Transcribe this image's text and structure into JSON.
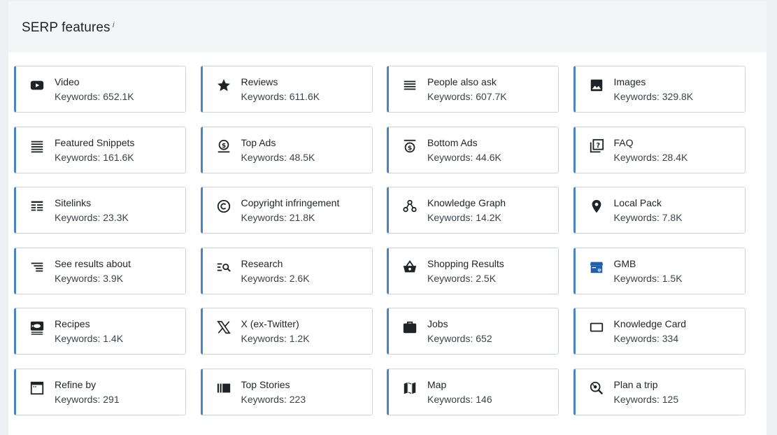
{
  "panel": {
    "title": "SERP features",
    "info_mark": "i"
  },
  "colors": {
    "accent_border": "#4a83c8",
    "card_border": "#cfd4db",
    "header_bg": "#f4f5f7"
  },
  "keywords_prefix": "Keywords: ",
  "features": [
    {
      "name": "Video",
      "keywords": "Keywords: 652.1K",
      "icon": "youtube-icon"
    },
    {
      "name": "Reviews",
      "keywords": "Keywords: 611.6K",
      "icon": "star-icon"
    },
    {
      "name": "People also ask",
      "keywords": "Keywords: 607.7K",
      "icon": "lines-icon"
    },
    {
      "name": "Images",
      "keywords": "Keywords: 329.8K",
      "icon": "image-icon"
    },
    {
      "name": "Featured Snippets",
      "keywords": "Keywords: 161.6K",
      "icon": "snippet-lines-icon"
    },
    {
      "name": "Top Ads",
      "keywords": "Keywords: 48.5K",
      "icon": "dollar-top-icon"
    },
    {
      "name": "Bottom Ads",
      "keywords": "Keywords: 44.6K",
      "icon": "dollar-bottom-icon"
    },
    {
      "name": "FAQ",
      "keywords": "Keywords: 28.4K",
      "icon": "faq-icon"
    },
    {
      "name": "Sitelinks",
      "keywords": "Keywords: 23.3K",
      "icon": "sitelinks-icon"
    },
    {
      "name": "Copyright infringement",
      "keywords": "Keywords: 21.8K",
      "icon": "copyright-icon"
    },
    {
      "name": "Knowledge Graph",
      "keywords": "Keywords: 14.2K",
      "icon": "graph-icon"
    },
    {
      "name": "Local Pack",
      "keywords": "Keywords: 7.8K",
      "icon": "map-pin-icon"
    },
    {
      "name": "See results about",
      "keywords": "Keywords: 3.9K",
      "icon": "list-indent-icon"
    },
    {
      "name": "Research",
      "keywords": "Keywords: 2.6K",
      "icon": "search-list-icon"
    },
    {
      "name": "Shopping Results",
      "keywords": "Keywords: 2.5K",
      "icon": "basket-icon"
    },
    {
      "name": "GMB",
      "keywords": "Keywords: 1.5K",
      "icon": "store-icon"
    },
    {
      "name": "Recipes",
      "keywords": "Keywords: 1.4K",
      "icon": "recipe-icon"
    },
    {
      "name": "X (ex-Twitter)",
      "keywords": "Keywords: 1.2K",
      "icon": "x-logo-icon"
    },
    {
      "name": "Jobs",
      "keywords": "Keywords: 652",
      "icon": "briefcase-icon"
    },
    {
      "name": "Knowledge Card",
      "keywords": "Keywords: 334",
      "icon": "card-icon"
    },
    {
      "name": "Refine by",
      "keywords": "Keywords: 291",
      "icon": "window-icon"
    },
    {
      "name": "Top Stories",
      "keywords": "Keywords: 223",
      "icon": "stories-icon"
    },
    {
      "name": "Map",
      "keywords": "Keywords: 146",
      "icon": "map-icon"
    },
    {
      "name": "Plan a trip",
      "keywords": "Keywords: 125",
      "icon": "trip-search-icon"
    }
  ]
}
